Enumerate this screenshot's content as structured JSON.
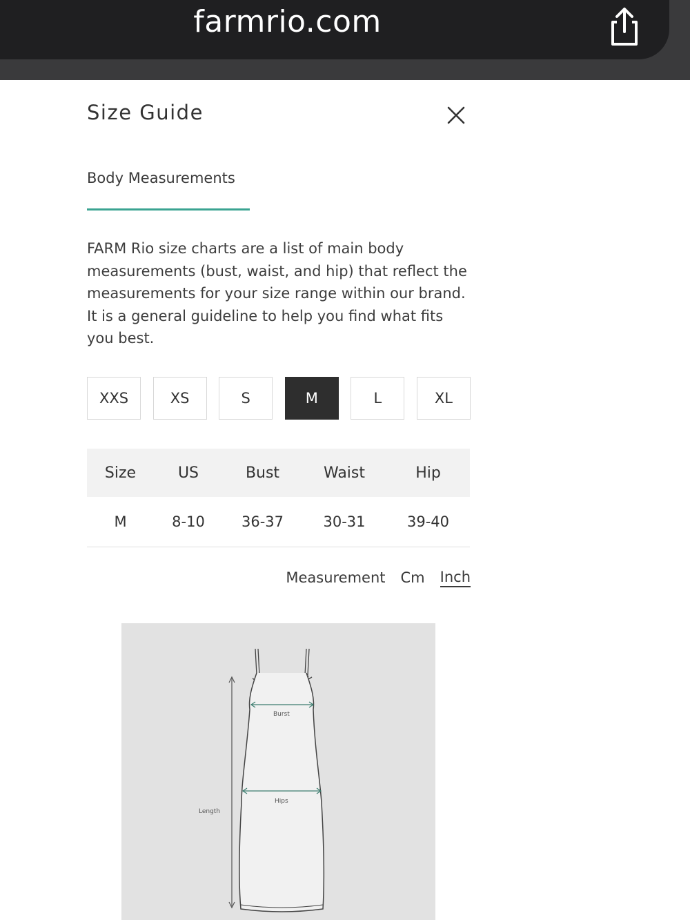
{
  "browser": {
    "url": "farmrio.com",
    "share_icon": "share-icon"
  },
  "modal": {
    "title": "Size Guide",
    "close_icon": "close-icon",
    "tab_label": "Body Measurements",
    "intro": "FARM Rio size charts are a list of main body measurements (bust, waist, and hip) that reflect the measurements for your size range within our brand. It is a general guideline to help you find what fits you best.",
    "sizes": [
      "XXS",
      "XS",
      "S",
      "M",
      "L",
      "XL"
    ],
    "selected_size": "M",
    "table": {
      "headers": [
        "Size",
        "US",
        "Bust",
        "Waist",
        "Hip"
      ],
      "rows": [
        [
          "M",
          "8-10",
          "36-37",
          "30-31",
          "39-40"
        ]
      ]
    },
    "units": {
      "label": "Measurement",
      "options": [
        "Cm",
        "Inch"
      ],
      "selected": "Inch"
    },
    "diagram": {
      "labels": {
        "bust": "Burst",
        "hips": "Hips",
        "length": "Length"
      }
    }
  },
  "colors": {
    "accent": "#3aa391",
    "selected_size_bg": "#2e2e2e",
    "browser_bar": "#1f1f21"
  }
}
